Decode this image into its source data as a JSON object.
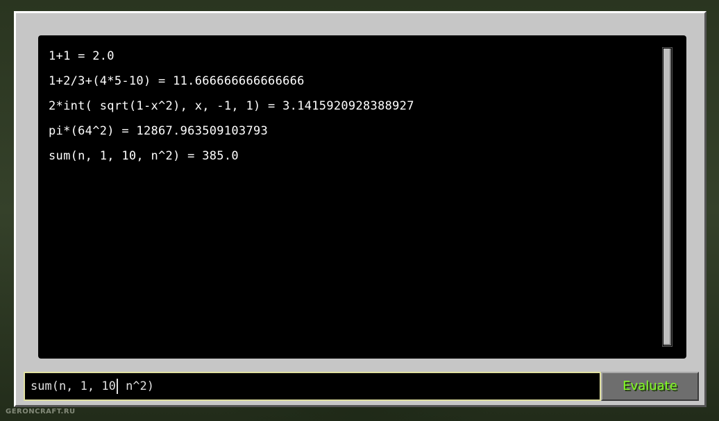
{
  "output": {
    "lines": [
      "1+1 = 2.0",
      "1+2/3+(4*5-10) = 11.666666666666666",
      "2*int( sqrt(1-x^2), x, -1, 1) = 3.1415920928388927",
      "pi*(64^2) = 12867.963509103793",
      "sum(n, 1, 10, n^2) = 385.0"
    ]
  },
  "input": {
    "value_before_caret": "sum(n, 1, 10",
    "value_after_caret": " n^2)"
  },
  "evaluate_button": {
    "label": "Evaluate",
    "color": "#80ff20"
  },
  "watermark": "GERONCRAFT.RU"
}
